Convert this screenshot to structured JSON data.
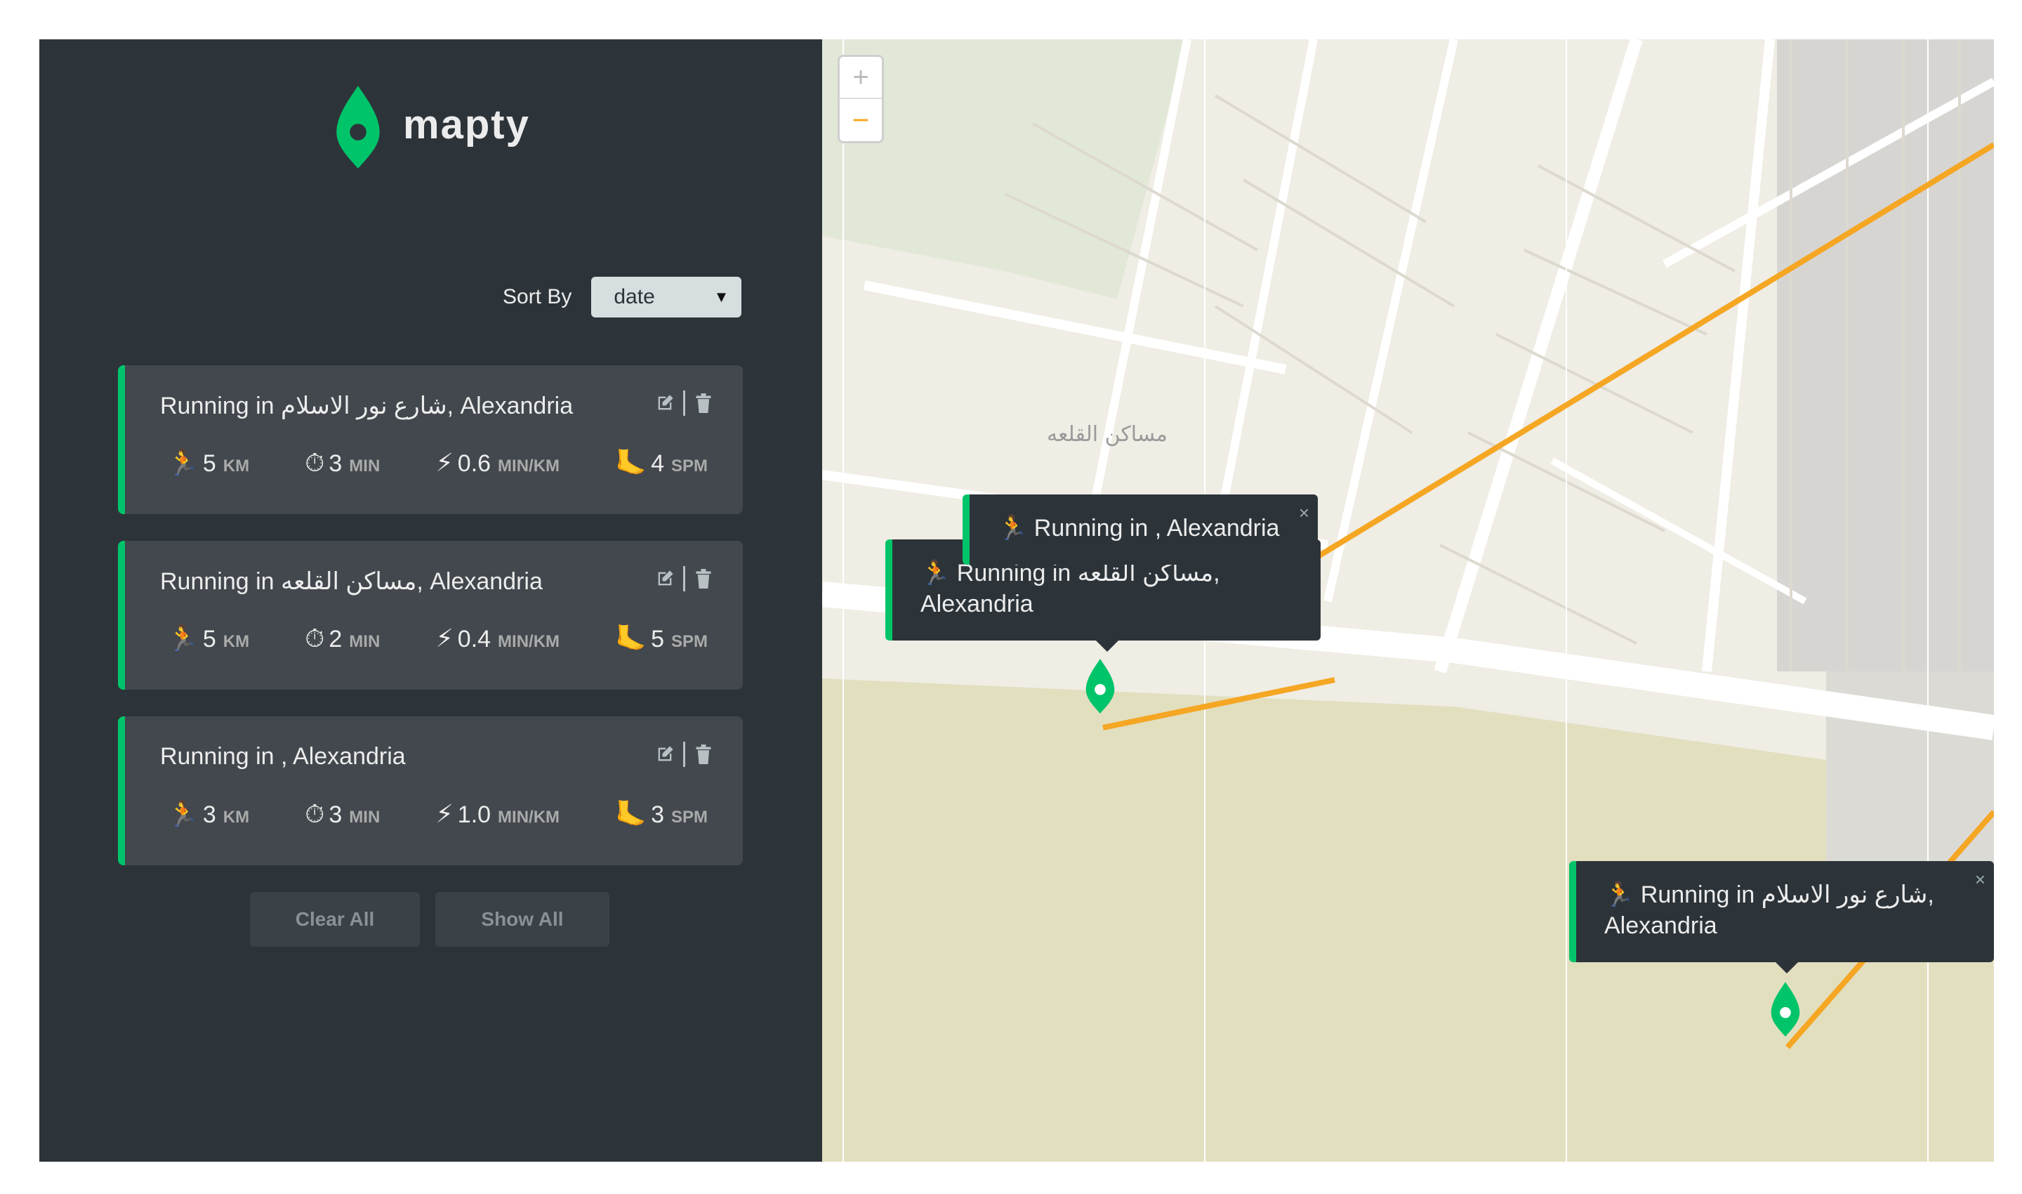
{
  "brand": {
    "name": "mapty",
    "color": "#00c46a"
  },
  "sort": {
    "label": "Sort By",
    "selected": "date"
  },
  "workouts": [
    {
      "title": "Running in شارع نور الاسلام, Alexandria",
      "stats": [
        {
          "icon": "runner-icon",
          "glyph": "🏃",
          "value": "5",
          "unit": "KM"
        },
        {
          "icon": "stopwatch-icon",
          "glyph": "⏱",
          "value": "3",
          "unit": "MIN"
        },
        {
          "icon": "lightning-icon",
          "glyph": "⚡",
          "value": "0.6",
          "unit": "MIN/KM"
        },
        {
          "icon": "footprint-icon",
          "glyph": "🦶",
          "value": "4",
          "unit": "SPM"
        }
      ]
    },
    {
      "title": "Running in مساكن القلعه, Alexandria",
      "stats": [
        {
          "icon": "runner-icon",
          "glyph": "🏃",
          "value": "5",
          "unit": "KM"
        },
        {
          "icon": "stopwatch-icon",
          "glyph": "⏱",
          "value": "2",
          "unit": "MIN"
        },
        {
          "icon": "lightning-icon",
          "glyph": "⚡",
          "value": "0.4",
          "unit": "MIN/KM"
        },
        {
          "icon": "footprint-icon",
          "glyph": "🦶",
          "value": "5",
          "unit": "SPM"
        }
      ]
    },
    {
      "title": "Running in , Alexandria",
      "stats": [
        {
          "icon": "runner-icon",
          "glyph": "🏃",
          "value": "3",
          "unit": "KM"
        },
        {
          "icon": "stopwatch-icon",
          "glyph": "⏱",
          "value": "3",
          "unit": "MIN"
        },
        {
          "icon": "lightning-icon",
          "glyph": "⚡",
          "value": "1.0",
          "unit": "MIN/KM"
        },
        {
          "icon": "footprint-icon",
          "glyph": "🦶",
          "value": "3",
          "unit": "SPM"
        }
      ]
    }
  ],
  "buttons": {
    "clear": "Clear All",
    "show": "Show All"
  },
  "map": {
    "zoom_in": "+",
    "zoom_out": "−",
    "area_label": "مساكن القلعه",
    "popups": [
      {
        "text": "🏃 Running in , Alexandria"
      },
      {
        "text": "🏃 Running in مساكن القلعه, Alexandria"
      },
      {
        "text": "🏃 Running in شارع نور الاسلام, Alexandria"
      }
    ],
    "route_color": "#f5a623",
    "close_glyph": "×"
  }
}
